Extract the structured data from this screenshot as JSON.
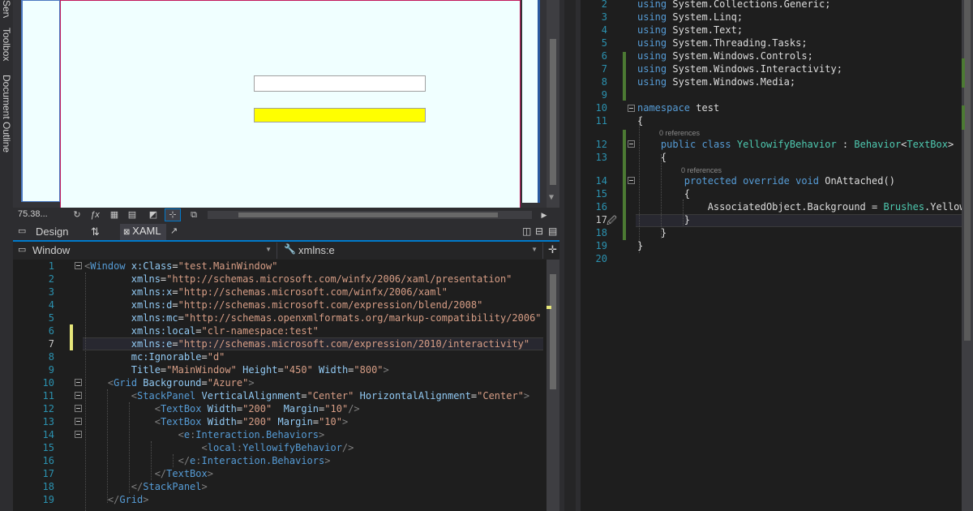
{
  "side_tabs": [
    "Server Explorer",
    "Toolbox",
    "Document Outline"
  ],
  "designer": {
    "background": "#F0FFFF",
    "textbox2_background": "#FFFF00"
  },
  "zoom_bar": {
    "zoom": "75.38..."
  },
  "split_tabs": {
    "design": "Design",
    "swap": "⇅",
    "xaml": "XAML"
  },
  "nav": {
    "left": "Window",
    "right": "xmlns:e"
  },
  "xaml_editor": {
    "line_numbers": [
      "1",
      "2",
      "3",
      "4",
      "5",
      "6",
      "7",
      "8",
      "9",
      "10",
      "11",
      "12",
      "13",
      "14",
      "15",
      "16",
      "17",
      "18",
      "19"
    ],
    "current_line": "7",
    "lines": [
      {
        "t": "<Window x:Class=\"test.MainWindow\""
      },
      {
        "t": "        xmlns=\"http://schemas.microsoft.com/winfx/2006/xaml/presentation\""
      },
      {
        "t": "        xmlns:x=\"http://schemas.microsoft.com/winfx/2006/xaml\""
      },
      {
        "t": "        xmlns:d=\"http://schemas.microsoft.com/expression/blend/2008\""
      },
      {
        "t": "        xmlns:mc=\"http://schemas.openxmlformats.org/markup-compatibility/2006\""
      },
      {
        "t": "        xmlns:local=\"clr-namespace:test\""
      },
      {
        "t": "        xmlns:e=\"http://schemas.microsoft.com/expression/2010/interactivity\""
      },
      {
        "t": "        mc:Ignorable=\"d\""
      },
      {
        "t": "        Title=\"MainWindow\" Height=\"450\" Width=\"800\">"
      },
      {
        "t": "    <Grid Background=\"Azure\">"
      },
      {
        "t": "        <StackPanel VerticalAlignment=\"Center\" HorizontalAlignment=\"Center\">"
      },
      {
        "t": "            <TextBox Width=\"200\"  Margin=\"10\"/>"
      },
      {
        "t": "            <TextBox Width=\"200\" Margin=\"10\">"
      },
      {
        "t": "                <e:Interaction.Behaviors>"
      },
      {
        "t": "                    <local:YellowifyBehavior/>"
      },
      {
        "t": "                </e:Interaction.Behaviors>"
      },
      {
        "t": "            </TextBox>"
      },
      {
        "t": "        </StackPanel>"
      },
      {
        "t": "    </Grid>"
      }
    ]
  },
  "cs_editor": {
    "line_numbers": [
      "2",
      "3",
      "4",
      "5",
      "6",
      "7",
      "8",
      "9",
      "10",
      "11",
      "12",
      "13",
      "14",
      "15",
      "16",
      "17",
      "18",
      "19",
      "20"
    ],
    "current_line": "17",
    "references": [
      "0 references",
      "0 references"
    ],
    "lines": [
      {
        "t": "using System.Collections.Generic;"
      },
      {
        "t": "using System.Linq;"
      },
      {
        "t": "using System.Text;"
      },
      {
        "t": "using System.Threading.Tasks;"
      },
      {
        "t": "using System.Windows.Controls;"
      },
      {
        "t": "using System.Windows.Interactivity;"
      },
      {
        "t": "using System.Windows.Media;"
      },
      {
        "t": ""
      },
      {
        "t": "namespace test"
      },
      {
        "t": "{"
      },
      {
        "t": "    public class YellowifyBehavior : Behavior<TextBox>"
      },
      {
        "t": "    {"
      },
      {
        "t": "        protected override void OnAttached()"
      },
      {
        "t": "        {"
      },
      {
        "t": "            AssociatedObject.Background = Brushes.Yellow;"
      },
      {
        "t": "        }"
      },
      {
        "t": "    }"
      },
      {
        "t": "}"
      },
      {
        "t": ""
      }
    ]
  }
}
